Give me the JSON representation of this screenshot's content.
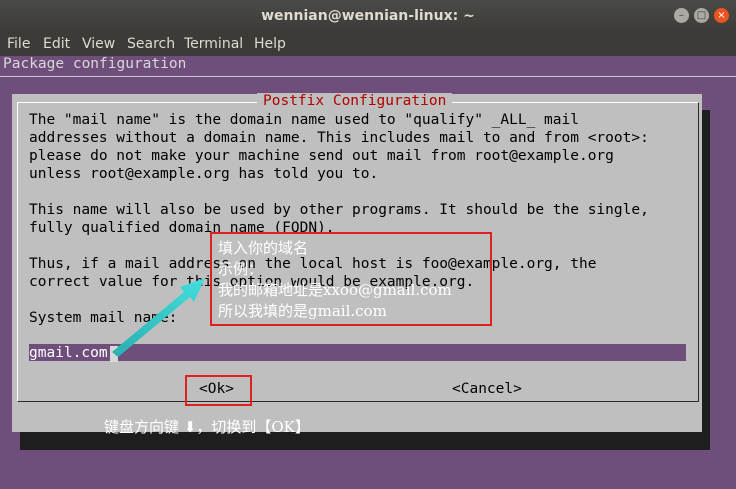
{
  "window": {
    "title": "wennian@wennian-linux: ~",
    "buttons": {
      "minimize": "–",
      "maximize": "□",
      "close": "×"
    }
  },
  "menu": [
    "File",
    "Edit",
    "View",
    "Search",
    "Terminal",
    "Help"
  ],
  "terminal": {
    "header": "Package configuration",
    "dialog": {
      "title": "Postfix Configuration",
      "lines": [
        "The \"mail name\" is the domain name used to \"qualify\" _ALL_ mail",
        "addresses without a domain name. This includes mail to and from <root>:",
        "please do not make your machine send out mail from root@example.org",
        "unless root@example.org has told you to.",
        "",
        "This name will also be used by other programs. It should be the single,",
        "fully qualified domain name (FQDN).",
        "",
        "Thus, if a mail address on the local host is foo@example.org, the",
        "correct value for this option would be example.org."
      ],
      "field_label": "System mail name:",
      "field_value": "gmail.com",
      "ok_label": "<Ok>",
      "cancel_label": "<Cancel>"
    }
  },
  "annotations": {
    "note_lines": [
      "填入你的域名",
      "示例：",
      "我的邮箱地址是xxoo@gmail.com",
      "所以我填的是gmail.com"
    ],
    "hint": "键盘方向键 ⬇，切换到【OK】",
    "colors": {
      "box": "#e02020",
      "arrow": "#33cccc",
      "text": "#ffffff"
    }
  }
}
